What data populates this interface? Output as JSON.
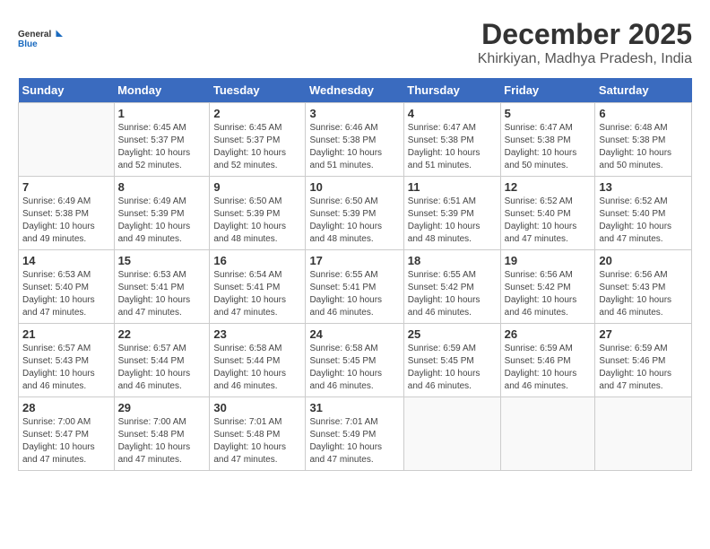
{
  "header": {
    "logo_line1": "General",
    "logo_line2": "Blue",
    "title": "December 2025",
    "subtitle": "Khirkiyan, Madhya Pradesh, India"
  },
  "weekdays": [
    "Sunday",
    "Monday",
    "Tuesday",
    "Wednesday",
    "Thursday",
    "Friday",
    "Saturday"
  ],
  "weeks": [
    [
      {
        "day": "",
        "info": ""
      },
      {
        "day": "1",
        "info": "Sunrise: 6:45 AM\nSunset: 5:37 PM\nDaylight: 10 hours\nand 52 minutes."
      },
      {
        "day": "2",
        "info": "Sunrise: 6:45 AM\nSunset: 5:37 PM\nDaylight: 10 hours\nand 52 minutes."
      },
      {
        "day": "3",
        "info": "Sunrise: 6:46 AM\nSunset: 5:38 PM\nDaylight: 10 hours\nand 51 minutes."
      },
      {
        "day": "4",
        "info": "Sunrise: 6:47 AM\nSunset: 5:38 PM\nDaylight: 10 hours\nand 51 minutes."
      },
      {
        "day": "5",
        "info": "Sunrise: 6:47 AM\nSunset: 5:38 PM\nDaylight: 10 hours\nand 50 minutes."
      },
      {
        "day": "6",
        "info": "Sunrise: 6:48 AM\nSunset: 5:38 PM\nDaylight: 10 hours\nand 50 minutes."
      }
    ],
    [
      {
        "day": "7",
        "info": "Sunrise: 6:49 AM\nSunset: 5:38 PM\nDaylight: 10 hours\nand 49 minutes."
      },
      {
        "day": "8",
        "info": "Sunrise: 6:49 AM\nSunset: 5:39 PM\nDaylight: 10 hours\nand 49 minutes."
      },
      {
        "day": "9",
        "info": "Sunrise: 6:50 AM\nSunset: 5:39 PM\nDaylight: 10 hours\nand 48 minutes."
      },
      {
        "day": "10",
        "info": "Sunrise: 6:50 AM\nSunset: 5:39 PM\nDaylight: 10 hours\nand 48 minutes."
      },
      {
        "day": "11",
        "info": "Sunrise: 6:51 AM\nSunset: 5:39 PM\nDaylight: 10 hours\nand 48 minutes."
      },
      {
        "day": "12",
        "info": "Sunrise: 6:52 AM\nSunset: 5:40 PM\nDaylight: 10 hours\nand 47 minutes."
      },
      {
        "day": "13",
        "info": "Sunrise: 6:52 AM\nSunset: 5:40 PM\nDaylight: 10 hours\nand 47 minutes."
      }
    ],
    [
      {
        "day": "14",
        "info": "Sunrise: 6:53 AM\nSunset: 5:40 PM\nDaylight: 10 hours\nand 47 minutes."
      },
      {
        "day": "15",
        "info": "Sunrise: 6:53 AM\nSunset: 5:41 PM\nDaylight: 10 hours\nand 47 minutes."
      },
      {
        "day": "16",
        "info": "Sunrise: 6:54 AM\nSunset: 5:41 PM\nDaylight: 10 hours\nand 47 minutes."
      },
      {
        "day": "17",
        "info": "Sunrise: 6:55 AM\nSunset: 5:41 PM\nDaylight: 10 hours\nand 46 minutes."
      },
      {
        "day": "18",
        "info": "Sunrise: 6:55 AM\nSunset: 5:42 PM\nDaylight: 10 hours\nand 46 minutes."
      },
      {
        "day": "19",
        "info": "Sunrise: 6:56 AM\nSunset: 5:42 PM\nDaylight: 10 hours\nand 46 minutes."
      },
      {
        "day": "20",
        "info": "Sunrise: 6:56 AM\nSunset: 5:43 PM\nDaylight: 10 hours\nand 46 minutes."
      }
    ],
    [
      {
        "day": "21",
        "info": "Sunrise: 6:57 AM\nSunset: 5:43 PM\nDaylight: 10 hours\nand 46 minutes."
      },
      {
        "day": "22",
        "info": "Sunrise: 6:57 AM\nSunset: 5:44 PM\nDaylight: 10 hours\nand 46 minutes."
      },
      {
        "day": "23",
        "info": "Sunrise: 6:58 AM\nSunset: 5:44 PM\nDaylight: 10 hours\nand 46 minutes."
      },
      {
        "day": "24",
        "info": "Sunrise: 6:58 AM\nSunset: 5:45 PM\nDaylight: 10 hours\nand 46 minutes."
      },
      {
        "day": "25",
        "info": "Sunrise: 6:59 AM\nSunset: 5:45 PM\nDaylight: 10 hours\nand 46 minutes."
      },
      {
        "day": "26",
        "info": "Sunrise: 6:59 AM\nSunset: 5:46 PM\nDaylight: 10 hours\nand 46 minutes."
      },
      {
        "day": "27",
        "info": "Sunrise: 6:59 AM\nSunset: 5:46 PM\nDaylight: 10 hours\nand 47 minutes."
      }
    ],
    [
      {
        "day": "28",
        "info": "Sunrise: 7:00 AM\nSunset: 5:47 PM\nDaylight: 10 hours\nand 47 minutes."
      },
      {
        "day": "29",
        "info": "Sunrise: 7:00 AM\nSunset: 5:48 PM\nDaylight: 10 hours\nand 47 minutes."
      },
      {
        "day": "30",
        "info": "Sunrise: 7:01 AM\nSunset: 5:48 PM\nDaylight: 10 hours\nand 47 minutes."
      },
      {
        "day": "31",
        "info": "Sunrise: 7:01 AM\nSunset: 5:49 PM\nDaylight: 10 hours\nand 47 minutes."
      },
      {
        "day": "",
        "info": ""
      },
      {
        "day": "",
        "info": ""
      },
      {
        "day": "",
        "info": ""
      }
    ]
  ]
}
